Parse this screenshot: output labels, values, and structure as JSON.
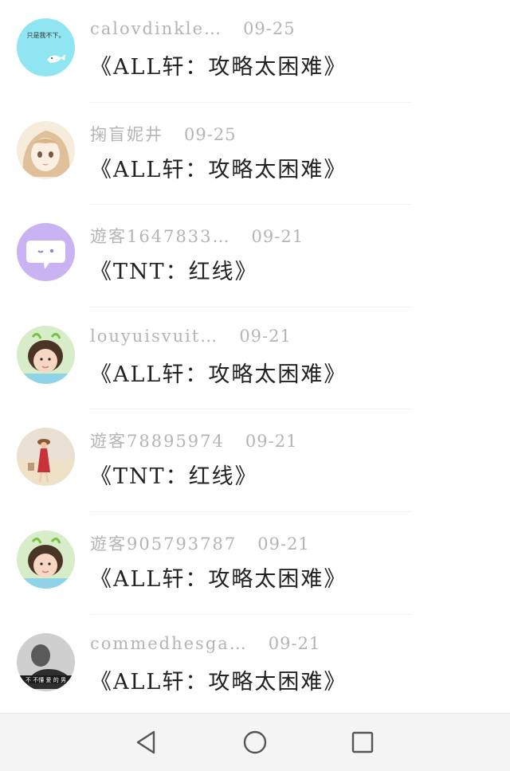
{
  "colors": {
    "meta_text": "#b4b4b4",
    "title_text": "#222222",
    "nav_bg": "#f4f4f4",
    "nav_icon": "#555555"
  },
  "comments": [
    {
      "user": "calovdinkle…",
      "date": "09-25",
      "title": "《ALL轩：攻略太困难》",
      "avatar": {
        "icon": "whale-avatar",
        "text": "只是我不下。"
      }
    },
    {
      "user": "掬盲妮井",
      "date": "09-25",
      "title": "《ALL轩：攻略太困难》",
      "avatar": {
        "icon": "anime-girl-avatar"
      }
    },
    {
      "user": "遊客1647833…",
      "date": "09-21",
      "title": "《TNT：红线》",
      "avatar": {
        "icon": "chat-bubble-avatar"
      }
    },
    {
      "user": "louyuisvuit…",
      "date": "09-21",
      "title": "《ALL轩：攻略太困难》",
      "avatar": {
        "icon": "child-photo-avatar"
      }
    },
    {
      "user": "遊客78895974",
      "date": "09-21",
      "title": "《TNT：红线》",
      "avatar": {
        "icon": "beach-photo-avatar"
      }
    },
    {
      "user": "遊客905793787",
      "date": "09-21",
      "title": "《ALL轩：攻略太困难》",
      "avatar": {
        "icon": "child-photo-avatar"
      }
    },
    {
      "user": "commedhesga…",
      "date": "09-21",
      "title": "《ALL轩：攻略太困难》",
      "avatar": {
        "icon": "bw-photo-avatar",
        "text": "不 不懂 爱 的 男"
      }
    }
  ],
  "navbar": {
    "back": "back-triangle-icon",
    "home": "home-circle-icon",
    "recents": "recents-square-icon"
  }
}
